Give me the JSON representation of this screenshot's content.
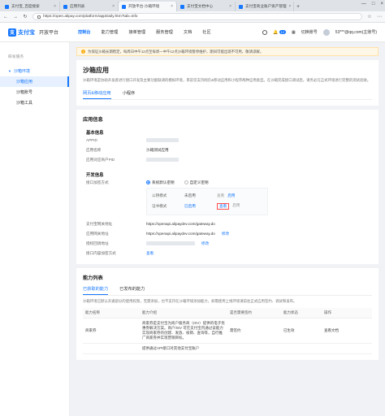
{
  "browser": {
    "tabs": [
      {
        "title": "支付宝_百度搜索",
        "active": false
      },
      {
        "title": "应用列表",
        "active": false
      },
      {
        "title": "开放平台-沙箱环境",
        "active": true
      },
      {
        "title": "支付宝文档中心",
        "active": false
      },
      {
        "title": "支付宝商业账户资产管理",
        "active": false
      }
    ],
    "url": "https://open.alipay.com/platform/appDaily.htm?tab=info"
  },
  "topnav": {
    "logo_text": "支付宝",
    "logo_sub": "开放平台",
    "menu": [
      "控制台",
      "能力管理",
      "接单管理",
      "服务管理",
      "文档",
      "社区"
    ],
    "active_index": 0,
    "badge": "12",
    "switch_account": "切换账号",
    "user_email": "53***@qq.com(主账号)"
  },
  "sidebar": {
    "group": "研发服务",
    "parent": "沙箱环境",
    "items": [
      "沙箱应用",
      "沙箱账号",
      "沙箱工具"
    ],
    "selected_index": 0
  },
  "notice": "为保证沙箱长期稳定，每周日中午12点至每周一中午12点沙箱环境暂停维护，期间可能出现不可用，敬请谅解。",
  "page": {
    "title": "沙箱应用",
    "desc": "沙箱环境是协助开发者进行接口开发及主要功能联调的模拟环境，目前仅支持网页&移动应用和小程序两种应用类型。在沙箱完成接口调试后，请务必在正式环境进行完整的测试验收。",
    "tabs": [
      "网页&移动应用",
      "小程序"
    ],
    "active_tab": 0
  },
  "app_info": {
    "section_title": "应用信息",
    "basic_title": "基本信息",
    "appid_label": "APPID",
    "name_label": "应用名称",
    "name_value": "沙箱测试应用",
    "gateway_label": "应用对应商户PID"
  },
  "dev_info": {
    "title": "开发信息",
    "signing_label": "接口加签方式",
    "signing_options": [
      "系统默认密钥",
      "自定义密钥"
    ],
    "signing_selected": 0,
    "modes": [
      {
        "name": "公钥模式",
        "status": "未启用",
        "actions": [
          "查看",
          "启用"
        ]
      },
      {
        "name": "证书模式",
        "status": "已启用",
        "actions": [
          "查看",
          "启用"
        ]
      }
    ],
    "gateway_addr_label": "支付宝网关地址",
    "gateway_addr": "https://openapi.alipaydev.com/gateway.do",
    "app_gateway_label": "应用网关地址",
    "app_gateway": "https://openapi.alipaydev.com/gateway.do",
    "app_gateway_action": "修改",
    "callback_label": "授权回调地址",
    "callback_action": "修改",
    "encrypt_label": "接口内容加密方式",
    "encrypt_action": "查看"
  },
  "capabilities": {
    "title": "能力列表",
    "tabs": [
      "已获取的能力",
      "已发布的能力"
    ],
    "active_tab": 0,
    "desc": "沙箱环境已默认开通部分的使用权限，无需添加，也不支持在沙箱环境添加能力，如需使用上线环境请前往正式应用签约、调试和发布。",
    "headers": [
      "能力名称",
      "能力介绍",
      "是否需要签约",
      "能力状态",
      "操作"
    ],
    "rows": [
      {
        "name": "商家券",
        "intro": "商家券是支付宝为商户服务商（ISV）提供的电子优惠券解决方案。商户/ISV 可在支付宝内通过该能力实现商家券的创建、发放、核销、查询等，自行推广商家券并实现营销目标。",
        "sign": "需签约",
        "status": "已生效",
        "action": "查看文档"
      },
      {
        "name": "",
        "intro": "提供通过API接口对其他支付宝账户",
        "sign": "",
        "status": "",
        "action": ""
      }
    ]
  }
}
